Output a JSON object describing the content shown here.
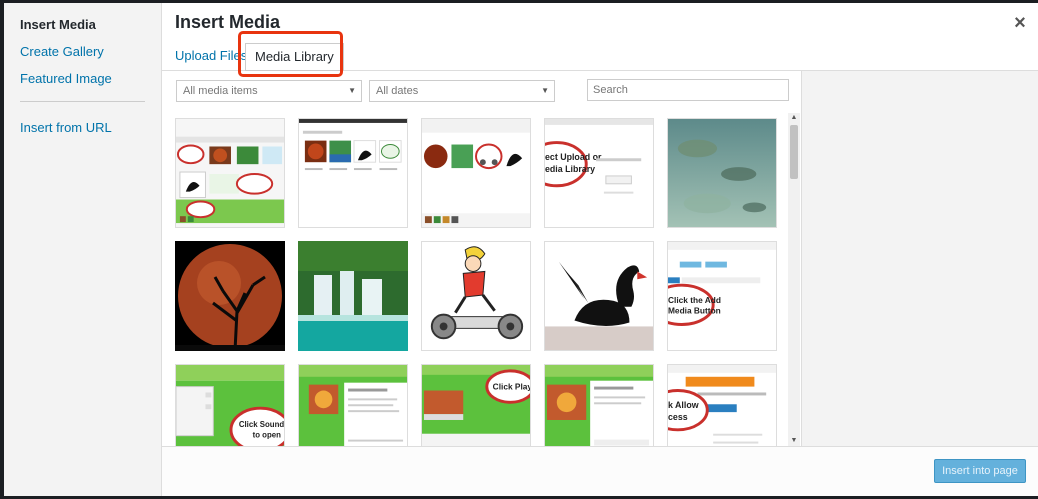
{
  "menu": {
    "items": [
      {
        "label": "Insert Media",
        "active": true
      },
      {
        "label": "Create Gallery"
      },
      {
        "label": "Featured Image"
      },
      {
        "label": "Insert from URL"
      }
    ]
  },
  "header": {
    "title": "Insert Media",
    "close": "×",
    "tabs": [
      {
        "label": "Upload Files"
      },
      {
        "label": "Media Library",
        "active": true
      }
    ]
  },
  "toolbar": {
    "media_filter": "All media items",
    "date_filter": "All dates",
    "search_placeholder": "Search"
  },
  "thumbnails": [
    {
      "name": "screenshot-media-grid"
    },
    {
      "name": "screenshot-swan-thumbnails"
    },
    {
      "name": "screenshot-inserted-images"
    },
    {
      "name": "screenshot-select-upload",
      "label": "ect Upload or\nedia Library"
    },
    {
      "name": "photo-underwater-rocks"
    },
    {
      "name": "photo-blood-moon-tree"
    },
    {
      "name": "photo-waterfall"
    },
    {
      "name": "clipart-running-woman"
    },
    {
      "name": "photo-black-swan"
    },
    {
      "name": "screenshot-add-media-button",
      "label": "Click the Add\nMedia Button"
    },
    {
      "name": "screenshot-sound-player",
      "label": "Click Sound Pl\nto open"
    },
    {
      "name": "screenshot-soundcloud-playlists"
    },
    {
      "name": "screenshot-click-playlist",
      "label": "Click Playlist"
    },
    {
      "name": "screenshot-soundcloud-music"
    },
    {
      "name": "screenshot-allow-access",
      "label": "k Allow\ncess"
    }
  ],
  "footer": {
    "insert_label": "Insert into page"
  },
  "colors": {
    "link": "#0073aa",
    "highlight": "#e8340f",
    "button": "#64b1dc"
  }
}
